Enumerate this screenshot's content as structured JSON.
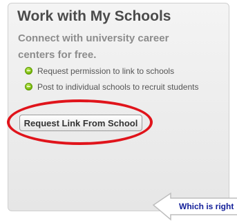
{
  "panel": {
    "title": "Work with My Schools",
    "subtitle": "Connect with university career centers for free.",
    "bullets": [
      {
        "icon": "green-bullet-icon",
        "text": "Request permission to link to schools"
      },
      {
        "icon": "green-bullet-icon",
        "text": "Post to individual schools to recruit students"
      }
    ],
    "request_button_label": "Request Link From School"
  },
  "annotation": {
    "oval_color": "#e0141b",
    "callout_text": "Which is right"
  }
}
